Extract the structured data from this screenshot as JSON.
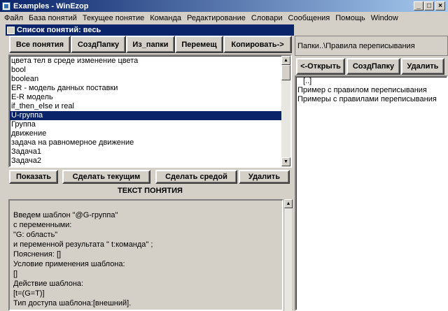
{
  "window": {
    "title": "Examples - WinEzop",
    "min": "_",
    "max": "□",
    "close": "×"
  },
  "menu": [
    "Файл",
    "База понятий",
    "Текущее понятие",
    "Команда",
    "Редактирование",
    "Словари",
    "Сообщения",
    "Помощь",
    "Window"
  ],
  "left_panel": {
    "title": "Список понятий: весь",
    "toolbar": [
      "Все понятия",
      "СоздПапку",
      "Из_папки",
      "Перемещ",
      "Копировать->"
    ],
    "concepts": [
      "цвета тел в среде изменение цвета",
      "bool",
      "boolean",
      "ER - модель данных поставки",
      "E-R модель",
      "if_then_else  и real",
      "U-группа",
      "Группа",
      "движение",
      "задача на равномерное движение",
      "Задача1",
      "Задача2"
    ],
    "selected_index": 6,
    "actions": [
      "Показать",
      "Сделать текущим",
      "Сделать средой",
      "Удалить"
    ],
    "text_header": "ТЕКСТ ПОНЯТИЯ",
    "concept_text": [
      "Введем шаблон \"@G-группа\"",
      "с переменными:",
      "\"G: область\"",
      "и переменной результата \" t:команда\" ;",
      "Пояснения: []",
      "Условие применения шаблона:",
      "[]",
      "Действие шаблона:",
      "[t=(G=T)]",
      "Тип доступа шаблона:[внешний]."
    ]
  },
  "right_panel": {
    "path": "Папки..\\Правила переписывания",
    "toolbar": [
      "<-Открыть",
      "СоздПапку",
      "Удалить"
    ],
    "items": [
      "[..]",
      "Пример с правилом переписывания",
      "Примеры с правилами переписывания"
    ]
  },
  "scroll": {
    "up_arrow": "▲",
    "down_arrow": "▼"
  }
}
